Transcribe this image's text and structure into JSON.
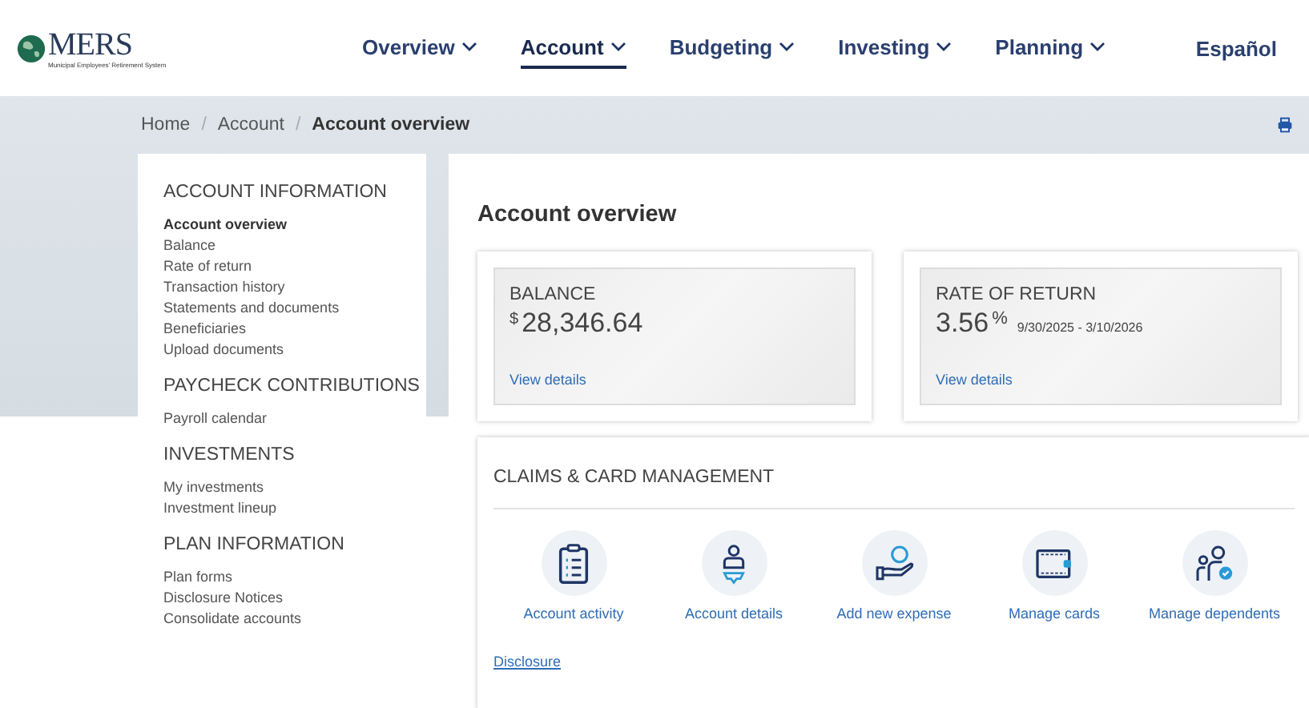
{
  "header": {
    "logo": {
      "name": "MERS",
      "tagline": "Municipal Employees' Retirement System"
    },
    "nav": [
      {
        "label": "Overview",
        "selected": false
      },
      {
        "label": "Account",
        "selected": true
      },
      {
        "label": "Budgeting",
        "selected": false
      },
      {
        "label": "Investing",
        "selected": false
      },
      {
        "label": "Planning",
        "selected": false
      }
    ],
    "language": "Español"
  },
  "breadcrumbs": [
    {
      "label": "Home",
      "selected": false
    },
    {
      "label": "Account",
      "selected": false
    },
    {
      "label": "Account overview",
      "selected": true
    }
  ],
  "breadcrumb_separator": "/",
  "sidebar": [
    {
      "heading": "ACCOUNT INFORMATION",
      "items": [
        {
          "label": "Account overview",
          "selected": true
        },
        {
          "label": "Balance",
          "selected": false
        },
        {
          "label": "Rate of return",
          "selected": false
        },
        {
          "label": "Transaction history",
          "selected": false
        },
        {
          "label": "Statements and documents",
          "selected": false
        },
        {
          "label": "Beneficiaries",
          "selected": false
        },
        {
          "label": "Upload documents",
          "selected": false
        }
      ]
    },
    {
      "heading": "PAYCHECK CONTRIBUTIONS",
      "items": [
        {
          "label": "Payroll calendar",
          "selected": false
        }
      ]
    },
    {
      "heading": "INVESTMENTS",
      "items": [
        {
          "label": "My investments",
          "selected": false
        },
        {
          "label": "Investment lineup",
          "selected": false
        }
      ]
    },
    {
      "heading": "PLAN INFORMATION",
      "items": [
        {
          "label": "Plan forms",
          "selected": false
        },
        {
          "label": "Disclosure Notices",
          "selected": false
        },
        {
          "label": "Consolidate accounts",
          "selected": false
        }
      ]
    }
  ],
  "main": {
    "title": "Account overview",
    "summary_cards": [
      {
        "title": "BALANCE",
        "prefix": "$",
        "value": "28,346.64",
        "link": "View details"
      },
      {
        "title": "RATE OF RETURN",
        "value": "3.56",
        "suffix": "%",
        "note": "9/30/2025 - 3/10/2026",
        "link": "View details"
      }
    ],
    "claims": {
      "title": "CLAIMS & CARD MANAGEMENT",
      "actions": [
        {
          "kind": "clipboard",
          "label": "Account activity"
        },
        {
          "kind": "person-gear",
          "label": "Account details"
        },
        {
          "kind": "hand-coin",
          "label": "Add new expense"
        },
        {
          "kind": "wallet",
          "label": "Manage cards"
        },
        {
          "kind": "people",
          "label": "Manage dependents"
        }
      ],
      "disclosure": "Disclosure"
    }
  }
}
